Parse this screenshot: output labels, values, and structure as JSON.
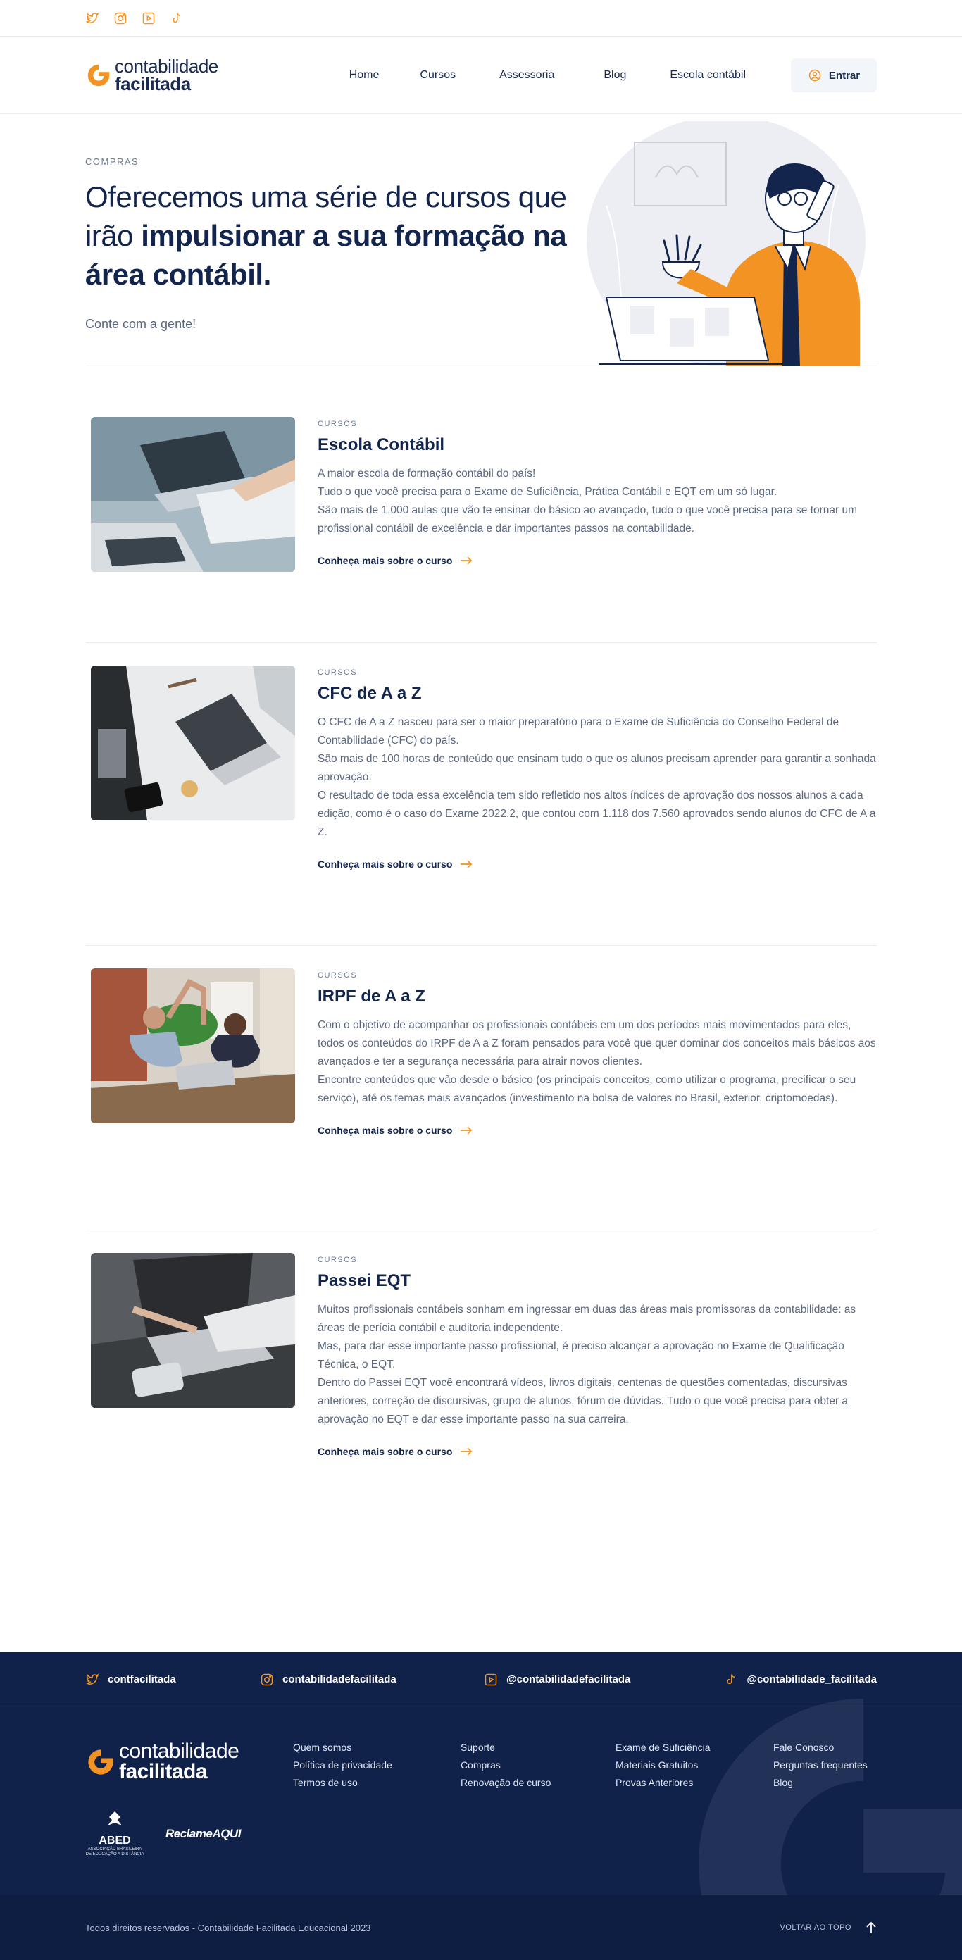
{
  "topbar": {
    "icons": [
      "twitter-icon",
      "instagram-icon",
      "youtube-icon",
      "tiktok-icon"
    ]
  },
  "header": {
    "logo_line1": "contabilidade",
    "logo_line2": "facilitada",
    "nav": [
      "Home",
      "Cursos",
      "Assessoria",
      "Blog",
      "Escola contábil"
    ],
    "login_label": "Entrar"
  },
  "hero": {
    "eyebrow": "COMPRAS",
    "title_plain": "Oferecemos uma série de cursos que irão ",
    "title_bold": "impulsionar a sua formação na área contábil.",
    "subtitle": "Conte com a gente!"
  },
  "courses": [
    {
      "tag": "CURSOS",
      "title": "Escola Contábil",
      "paragraphs": [
        "A maior escola de formação contábil do país!",
        "Tudo o que você precisa para o Exame de Suficiência, Prática Contábil e EQT em um só lugar.",
        "São mais de 1.000 aulas que vão te ensinar do básico ao avançado, tudo o que você precisa para se tornar um profissional contábil de excelência e dar importantes passos na contabilidade."
      ],
      "cta": "Conheça mais sobre o curso"
    },
    {
      "tag": "CURSOS",
      "title": "CFC de A a Z",
      "paragraphs": [
        "O CFC de A a Z nasceu para ser o maior preparatório para o Exame de Suficiência do Conselho Federal de Contabilidade (CFC) do país.",
        "São mais de 100 horas de conteúdo que ensinam tudo o que os alunos precisam aprender para garantir a sonhada aprovação.",
        "O resultado de toda essa excelência tem sido refletido nos altos índices de aprovação dos nossos alunos a cada edição, como é o caso do Exame 2022.2, que contou com 1.118 dos 7.560 aprovados sendo alunos do CFC de A a Z."
      ],
      "cta": "Conheça mais sobre o curso"
    },
    {
      "tag": "CURSOS",
      "title": "IRPF de A a Z",
      "paragraphs": [
        "Com o objetivo de acompanhar os profissionais contábeis em um dos períodos mais movimentados para eles, todos os conteúdos do IRPF de A a Z foram pensados para você que quer dominar dos conceitos mais básicos aos avançados e ter a segurança necessária para atrair novos clientes.",
        "Encontre conteúdos que vão desde o básico (os principais conceitos, como utilizar o programa, precificar o seu serviço), até os temas mais avançados (investimento na bolsa de valores no Brasil, exterior, criptomoedas)."
      ],
      "cta": "Conheça mais sobre o curso"
    },
    {
      "tag": "CURSOS",
      "title": "Passei EQT",
      "paragraphs": [
        "Muitos profissionais contábeis sonham em ingressar em duas das áreas mais promissoras da contabilidade: as áreas de perícia contábil e auditoria independente.",
        "Mas, para dar esse importante passo profissional, é preciso alcançar a aprovação no Exame de Qualificação Técnica, o EQT.",
        "Dentro do Passei EQT você encontrará vídeos, livros digitais, centenas de questões comentadas, discursivas anteriores, correção de discursivas, grupo de alunos, fórum de dúvidas. Tudo o que você precisa para obter a aprovação no EQT e dar esse importante passo na sua carreira."
      ],
      "cta": "Conheça mais sobre o curso"
    }
  ],
  "footer": {
    "social": [
      {
        "icon": "twitter-icon",
        "label": "contfacilitada"
      },
      {
        "icon": "instagram-icon",
        "label": "contabilidadefacilitada"
      },
      {
        "icon": "youtube-icon",
        "label": "@contabilidadefacilitada"
      },
      {
        "icon": "tiktok-icon",
        "label": "@contabilidade_facilitada"
      }
    ],
    "logo_line1": "contabilidade",
    "logo_line2": "facilitada",
    "columns": [
      [
        "Quem somos",
        "Política de privacidade",
        "Termos de uso"
      ],
      [
        "Suporte",
        "Compras",
        "Renovação de curso"
      ],
      [
        "Exame de Suficiência",
        "Materiais Gratuitos",
        "Provas Anteriores"
      ],
      [
        "Fale Conosco",
        "Perguntas frequentes",
        "Blog"
      ]
    ],
    "abed_name": "ABED",
    "abed_small": "ASSOCIAÇÃO BRASILEIRA DE EDUCAÇÃO A DISTÂNCIA",
    "reclame": "ReclameAQUI",
    "copyright": "Todos direitos reservados - Contabilidade Facilitada Educacional 2023",
    "to_top": "VOLTAR AO TOPO"
  },
  "colors": {
    "accent": "#f39323",
    "navy": "#13254d",
    "footer_bg": "#10214a"
  }
}
